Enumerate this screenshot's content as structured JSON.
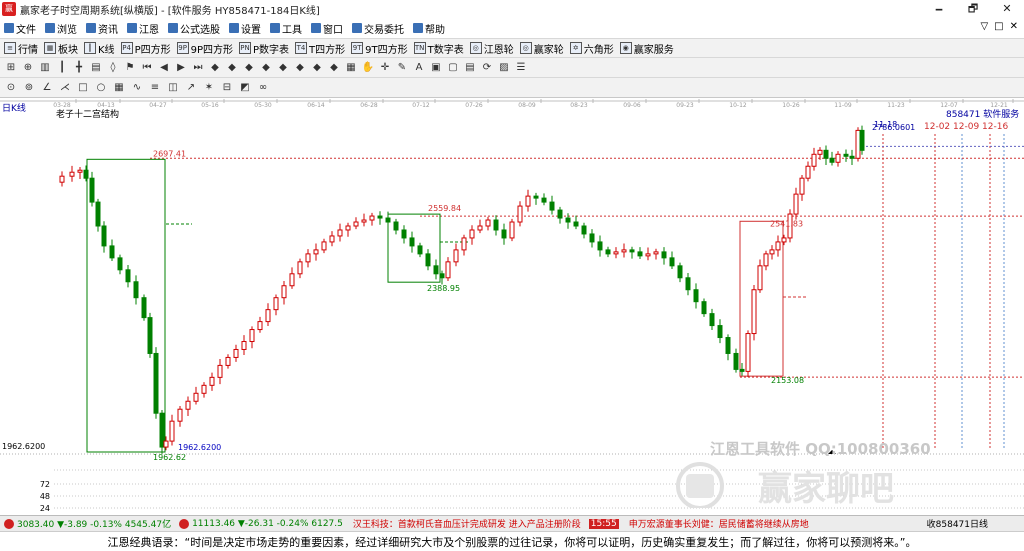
{
  "window": {
    "title": "赢家老子时空周期系统[纵横版] - [软件服务   HY858471-184日K线]",
    "minimize": "🗕",
    "restore": "🗗",
    "close": "✕"
  },
  "menu": {
    "items": [
      "文件",
      "浏览",
      "资讯",
      "江恩",
      "公式选股",
      "设置",
      "工具",
      "窗口",
      "交易委托",
      "帮助"
    ],
    "right_tools": [
      "▽",
      "□",
      "✕"
    ]
  },
  "toolbar1": {
    "items": [
      {
        "label": "行情",
        "icon": "quote-icon"
      },
      {
        "label": "板块",
        "icon": "sector-icon"
      },
      {
        "label": "K线",
        "icon": "kline-icon"
      },
      {
        "label": "P四方形",
        "icon": "p-square-icon",
        "badge": "P4"
      },
      {
        "label": "9P四方形",
        "icon": "9p-square-icon",
        "badge": "9P"
      },
      {
        "label": "P数字表",
        "icon": "p-table-icon",
        "badge": "PN"
      },
      {
        "label": "T四方形",
        "icon": "t-square-icon",
        "badge": "T4"
      },
      {
        "label": "9T四方形",
        "icon": "9t-square-icon",
        "badge": "9T"
      },
      {
        "label": "T数字表",
        "icon": "t-table-icon",
        "badge": "TN"
      },
      {
        "label": "江恩轮",
        "icon": "gann-wheel-icon",
        "badge": "◎"
      },
      {
        "label": "赢家轮",
        "icon": "winner-wheel-icon",
        "badge": "◎"
      },
      {
        "label": "六角形",
        "icon": "hexagon-icon",
        "badge": "✡"
      },
      {
        "label": "赢家服务",
        "icon": "service-icon",
        "badge": "◉"
      }
    ]
  },
  "chart_labels": {
    "period": "日K线",
    "structure": "老子十二宫结构",
    "stock": "858471  软件服务",
    "dates_top": "12-02  12-09  12-16",
    "high_short": "11-18"
  },
  "chart_data": {
    "type": "candlestick",
    "x_ticks": [
      "03-28",
      "04-13",
      "04-27",
      "05-16",
      "05-30",
      "06-14",
      "06-28",
      "07-12",
      "07-26",
      "08-09",
      "08-23",
      "09-06",
      "09-23",
      "10-12",
      "10-26",
      "11-09",
      "11-23",
      "12-07",
      "12-21"
    ],
    "y_ticks": [
      "1962.6200"
    ],
    "volume_ticks": [
      "72",
      "48",
      "24"
    ],
    "price_labels": [
      {
        "text": "2697.41",
        "value": 2697.41
      },
      {
        "text": "2559.84",
        "value": 2559.84
      },
      {
        "text": "2388.95",
        "value": 2388.95
      },
      {
        "text": "2541.83",
        "value": 2541.83
      },
      {
        "text": "2153.08",
        "value": 2153.08
      },
      {
        "text": "1962.62",
        "value": 1962.62
      },
      {
        "text": "1962.6200",
        "value": 1962.62
      },
      {
        "text": "2786.0601",
        "value": 2786.06
      }
    ],
    "boxes": [
      {
        "from": "04-06",
        "to": "04-27",
        "high": 2697.41,
        "low": 1962.62
      },
      {
        "from": "07-01",
        "to": "07-14",
        "high": 2559.84,
        "low": 2388.95
      },
      {
        "from": "10-10",
        "to": "10-24",
        "high": 2541.83,
        "low": 2153.08
      }
    ],
    "grid": false
  },
  "watermark": {
    "tool": "江恩工具软件  QQ:100800360",
    "brand": "赢家聊吧"
  },
  "status": {
    "sh_index": "3083.40 ▼-3.89 -0.13% 4545.47亿",
    "sz_index": "11113.46 ▼-26.31 -0.24% 6127.5",
    "news1": "汉王科技：首款柯氏音血压计完成研发 进入产品注册阶段",
    "time": "15:55",
    "news2": "申万宏源董事长刘健：居民储蓄将继续从房地",
    "right": "收858471日线"
  },
  "quote": "江恩经典语录：“时间是决定市场走势的重要因素，经过详细研究大市及个别股票的过往记录，你将可以证明，历史确实重复发生；而了解过往，你将可以预测将来。”。",
  "colors": {
    "up": "#d00000",
    "down": "#008000",
    "label_red": "#d03030",
    "accent": "#0000a0"
  }
}
